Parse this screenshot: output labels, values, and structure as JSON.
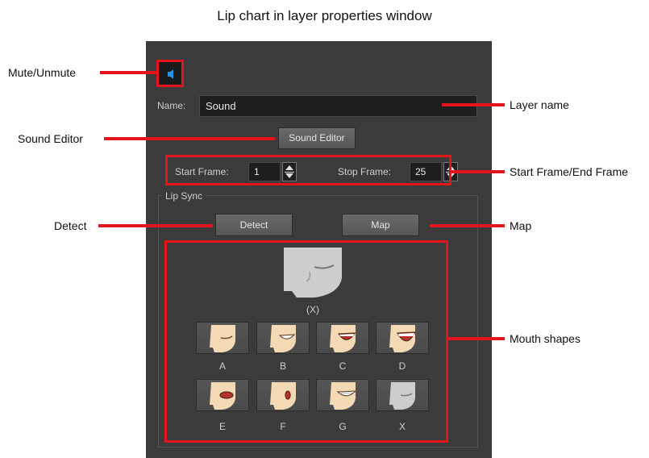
{
  "title": "Lip chart in layer properties window",
  "name_label": "Name:",
  "name_value": "Sound",
  "sound_editor_label": "Sound Editor",
  "start_frame_label": "Start Frame:",
  "start_frame_value": "1",
  "stop_frame_label": "Stop Frame:",
  "stop_frame_value": "25",
  "lip_sync_label": "Lip Sync",
  "detect_label": "Detect",
  "map_label": "Map",
  "current_shape_label": "(X)",
  "mouth_shapes": [
    "A",
    "B",
    "C",
    "D",
    "E",
    "F",
    "G",
    "X"
  ],
  "callouts": {
    "mute": "Mute/Unmute",
    "sound_editor": "Sound Editor",
    "detect": "Detect",
    "layer_name": "Layer name",
    "frames": "Start Frame/End Frame",
    "map": "Map",
    "mouth_shapes": "Mouth shapes"
  },
  "colors": {
    "annotation_red": "#e3141b",
    "panel_bg": "#3b3b3b",
    "speaker_blue": "#2a8fe0"
  },
  "icons": {
    "mute": "speaker-icon",
    "spin": "spin-arrows-icon",
    "mouth": "mouth-shape-icon"
  }
}
